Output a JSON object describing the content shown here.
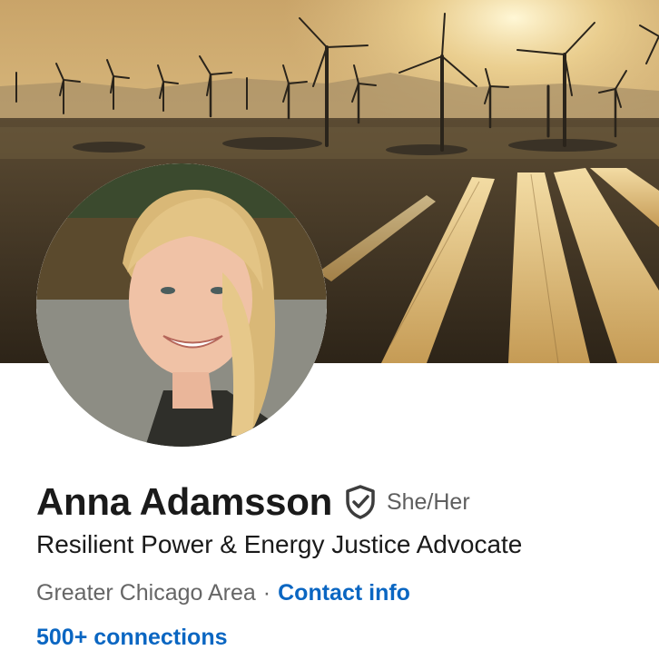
{
  "profile": {
    "name": "Anna Adamsson",
    "pronouns": "She/Her",
    "headline": "Resilient Power & Energy Justice Advocate",
    "location": "Greater Chicago Area",
    "separator": "·",
    "contact_label": "Contact info",
    "connections_label": "500+ connections"
  },
  "banner": {
    "scene": "wind turbines and solar panel rows at sunset"
  },
  "icons": {
    "verified": "verified-shield-icon"
  },
  "colors": {
    "link": "#0a66c2",
    "name": "#1a1a1a",
    "secondary": "#666666",
    "badge": "#3d3d3d"
  }
}
